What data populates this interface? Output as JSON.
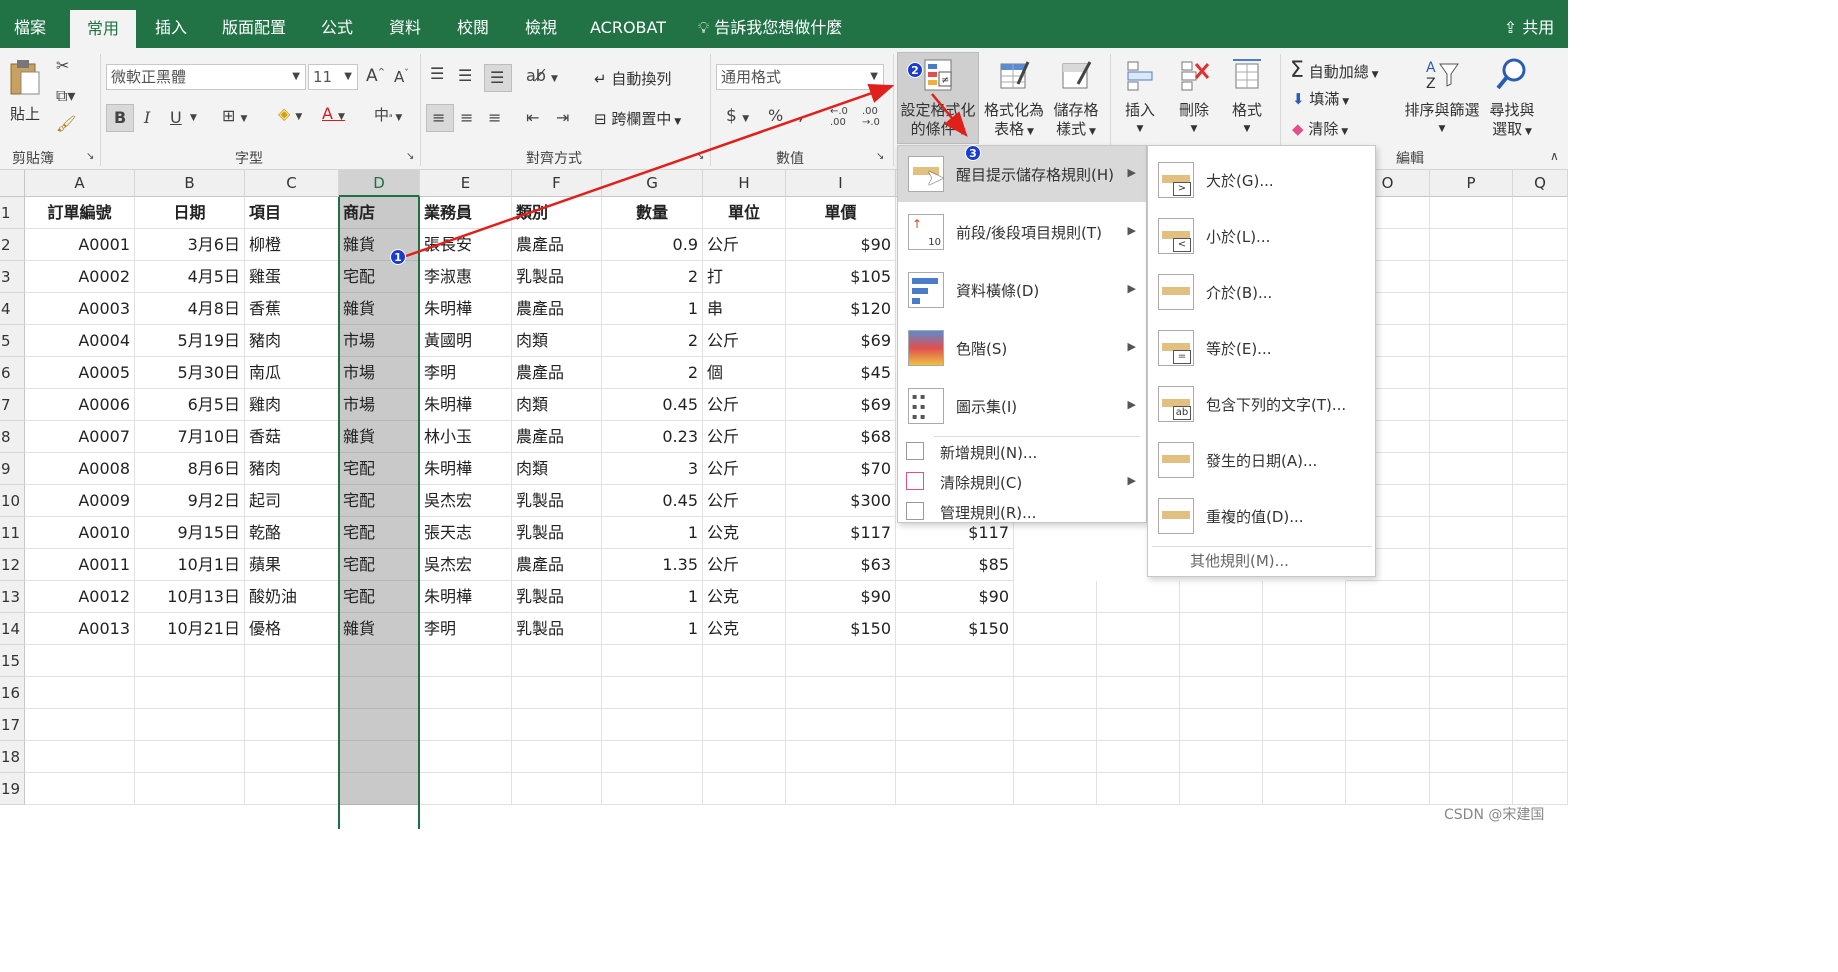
{
  "tabs": [
    "檔案",
    "常用",
    "插入",
    "版面配置",
    "公式",
    "資料",
    "校閱",
    "檢視",
    "ACROBAT"
  ],
  "tellme": "告訴我您想做什麼",
  "share": "共用",
  "ribbon": {
    "paste": "貼上",
    "font_name": "微軟正黑體",
    "font_size": "11",
    "bold": "B",
    "italic": "I",
    "underline": "U",
    "font_color_letter": "A",
    "phonetic": "中",
    "wrap_text": "自動換列",
    "merge_center": "跨欄置中",
    "number_format": "通用格式",
    "currency": "$",
    "percent": "%",
    "comma": ",",
    "cond_format": [
      "設定格式化",
      "的條件"
    ],
    "format_as_table": [
      "格式化為",
      "表格"
    ],
    "cell_styles": [
      "儲存格",
      "樣式"
    ],
    "insert": "插入",
    "delete": "刪除",
    "format": "格式",
    "autosum": "自動加總",
    "fill": "填滿",
    "clear": "清除",
    "sort_filter": [
      "排序與篩選"
    ],
    "find_select": [
      "尋找與",
      "選取"
    ],
    "groups": [
      "剪貼簿",
      "字型",
      "對齊方式",
      "數值",
      "編輯"
    ]
  },
  "columns": [
    "A",
    "B",
    "C",
    "D",
    "E",
    "F",
    "G",
    "H",
    "I",
    "",
    "",
    "",
    "",
    "",
    "O",
    "P",
    "Q"
  ],
  "rows": [
    "1",
    "2",
    "3",
    "4",
    "5",
    "6",
    "7",
    "8",
    "9",
    "10",
    "11",
    "12",
    "13",
    "14",
    "15",
    "16",
    "17",
    "18",
    "19"
  ],
  "table": {
    "headers": [
      "訂單編號",
      "日期",
      "項目",
      "商店",
      "業務員",
      "類別",
      "數量",
      "單位",
      "單價"
    ],
    "data": [
      [
        "A0001",
        "3月6日",
        "柳橙",
        "雜貨",
        "張長安",
        "農產品",
        "0.9",
        "公斤",
        "$90"
      ],
      [
        "A0002",
        "4月5日",
        "雞蛋",
        "宅配",
        "李淑惠",
        "乳製品",
        "2",
        "打",
        "$105"
      ],
      [
        "A0003",
        "4月8日",
        "香蕉",
        "雜貨",
        "朱明樺",
        "農產品",
        "1",
        "串",
        "$120"
      ],
      [
        "A0004",
        "5月19日",
        "豬肉",
        "市場",
        "黃國明",
        "肉類",
        "2",
        "公斤",
        "$69"
      ],
      [
        "A0005",
        "5月30日",
        "南瓜",
        "市場",
        "李明",
        "農產品",
        "2",
        "個",
        "$45"
      ],
      [
        "A0006",
        "6月5日",
        "雞肉",
        "市場",
        "朱明樺",
        "肉類",
        "0.45",
        "公斤",
        "$69"
      ],
      [
        "A0007",
        "7月10日",
        "香菇",
        "雜貨",
        "林小玉",
        "農產品",
        "0.23",
        "公斤",
        "$68"
      ],
      [
        "A0008",
        "8月6日",
        "豬肉",
        "宅配",
        "朱明樺",
        "肉類",
        "3",
        "公斤",
        "$70"
      ],
      [
        "A0009",
        "9月2日",
        "起司",
        "宅配",
        "吳杰宏",
        "乳製品",
        "0.45",
        "公斤",
        "$300"
      ],
      [
        "A0010",
        "9月15日",
        "乾酪",
        "宅配",
        "張天志",
        "乳製品",
        "1",
        "公克",
        "$117"
      ],
      [
        "A0011",
        "10月1日",
        "蘋果",
        "宅配",
        "吳杰宏",
        "農產品",
        "1.35",
        "公斤",
        "$63"
      ],
      [
        "A0012",
        "10月13日",
        "酸奶油",
        "宅配",
        "朱明樺",
        "乳製品",
        "1",
        "公克",
        "$90"
      ],
      [
        "A0013",
        "10月21日",
        "優格",
        "雜貨",
        "李明",
        "乳製品",
        "1",
        "公克",
        "$150"
      ]
    ],
    "extra_j": [
      "$117",
      "$85",
      "$90",
      "$150"
    ]
  },
  "menu": {
    "items": [
      "醒目提示儲存格規則(H)",
      "前段/後段項目規則(T)",
      "資料橫條(D)",
      "色階(S)",
      "圖示集(I)"
    ],
    "small_items": [
      "新增規則(N)...",
      "清除規則(C)",
      "管理規則(R)..."
    ],
    "top_bottom_icon_text": "10"
  },
  "submenu": {
    "items": [
      "大於(G)...",
      "小於(L)...",
      "介於(B)...",
      "等於(E)...",
      "包含下列的文字(T)...",
      "發生的日期(A)...",
      "重複的值(D)..."
    ],
    "icon_glyphs": [
      ">",
      "<",
      "",
      "=",
      "ab",
      "",
      ""
    ],
    "more": "其他規則(M)..."
  },
  "badges": [
    "1",
    "2",
    "3"
  ],
  "watermark": "CSDN @宋建国",
  "colors": {
    "excel_green": "#217346",
    "arrow_red": "#e0201b",
    "badge_blue": "#1a3ccf"
  }
}
